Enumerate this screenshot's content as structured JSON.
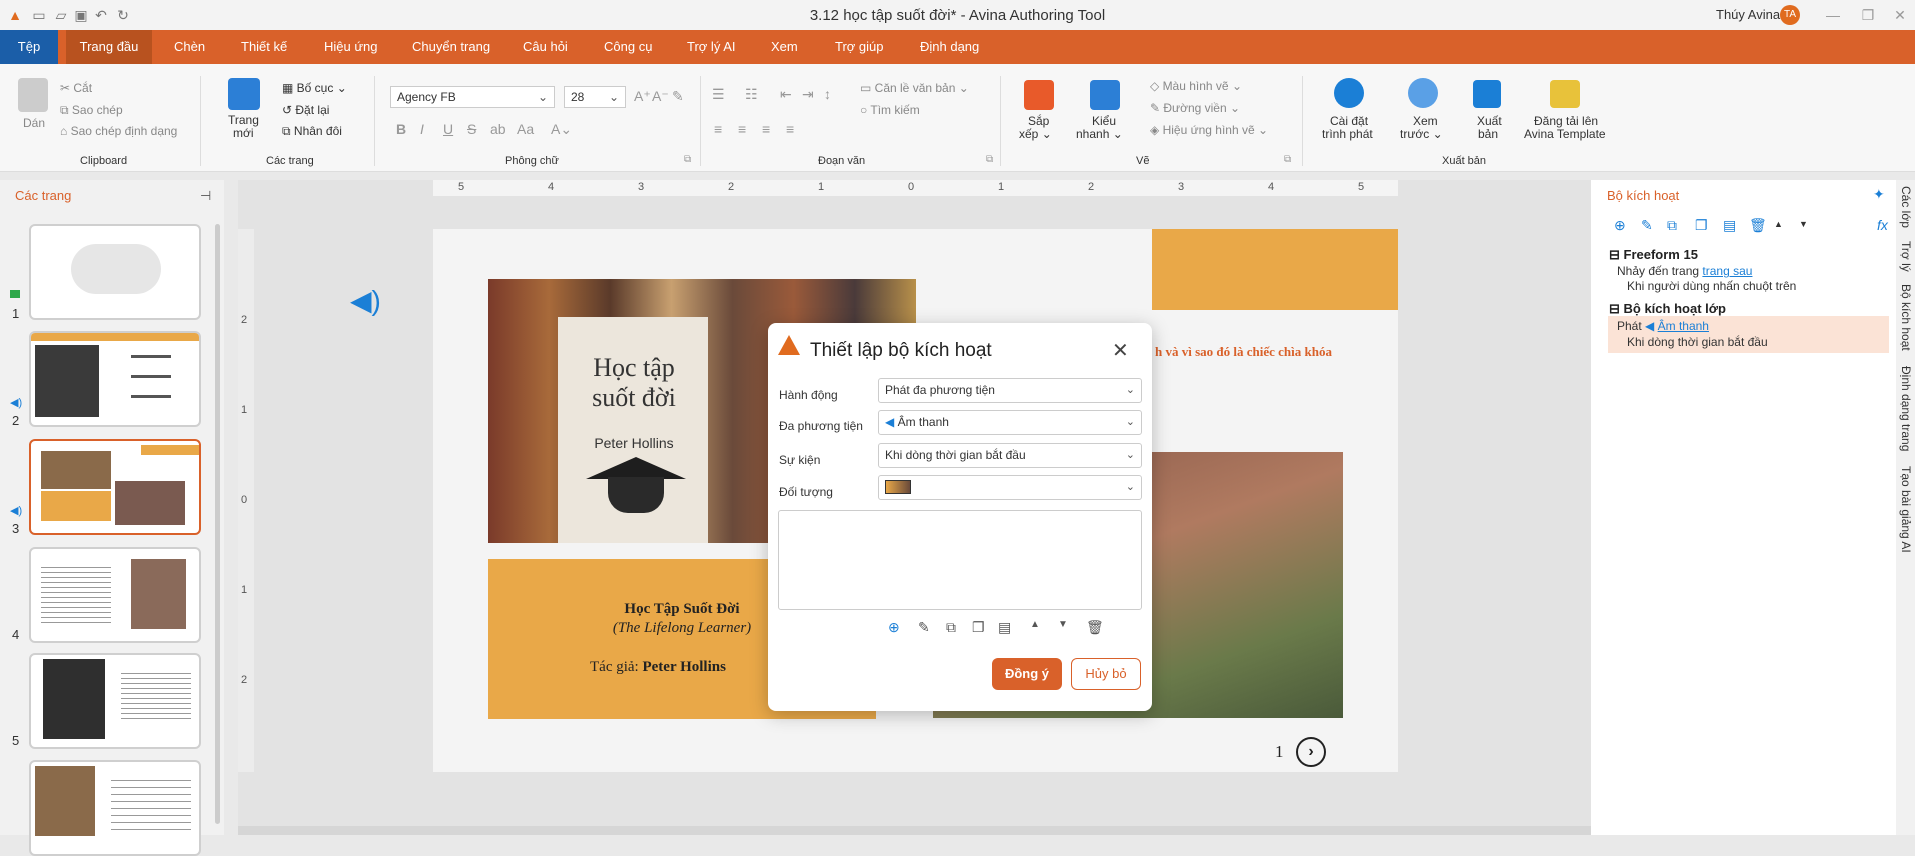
{
  "window": {
    "title": "3.12 học tập suốt đời* - Avina Authoring Tool",
    "user_name": "Thúy Avina",
    "user_initials": "TA"
  },
  "menu": [
    {
      "label": "Tệp"
    },
    {
      "label": "Trang đầu"
    },
    {
      "label": "Chèn"
    },
    {
      "label": "Thiết kế"
    },
    {
      "label": "Hiệu ứng"
    },
    {
      "label": "Chuyển trang"
    },
    {
      "label": "Câu hỏi"
    },
    {
      "label": "Công cụ"
    },
    {
      "label": "Trợ lý AI"
    },
    {
      "label": "Xem"
    },
    {
      "label": "Trợ giúp"
    },
    {
      "label": "Định dạng"
    }
  ],
  "ribbon": {
    "clipboard": {
      "paste": "Dán",
      "cut": "Cắt",
      "copy": "Sao chép",
      "copy_format": "Sao chép định dạng",
      "group": "Clipboard"
    },
    "pages": {
      "new_page": "Trang",
      "new_page2": "mới",
      "layout": "Bố cục",
      "reset": "Đặt lại",
      "duplicate": "Nhân đôi",
      "group": "Các trang"
    },
    "font": {
      "family": "Agency FB",
      "size": "28",
      "group": "Phông chữ"
    },
    "paragraph": {
      "align_text": "Căn lề văn bản",
      "find": "Tìm kiếm",
      "group": "Đoạn văn"
    },
    "draw": {
      "arrange": "Sắp",
      "arrange2": "xếp",
      "quick_style": "Kiểu",
      "quick_style2": "nhanh",
      "shape_color": "Màu hình vẽ",
      "outline": "Đường viền",
      "shape_effect": "Hiệu ứng hình vẽ",
      "group": "Vẽ"
    },
    "publish": {
      "player": "Cài đặt",
      "player2": "trình phát",
      "preview": "Xem",
      "preview2": "trước",
      "export": "Xuất",
      "export2": "bản",
      "upload": "Đăng tải lên",
      "upload2": "Avina Template",
      "group": "Xuất bản"
    }
  },
  "pages_panel": {
    "title": "Các trang",
    "page_numbers": [
      "1",
      "2",
      "3",
      "4",
      "5"
    ]
  },
  "ruler": {
    "ticks": [
      "5",
      "4",
      "3",
      "2",
      "1",
      "0",
      "1",
      "2",
      "3",
      "4",
      "5"
    ],
    "vticks": [
      "2",
      "1",
      "0",
      "1",
      "2"
    ]
  },
  "slide": {
    "book_title": "Học Tập Suốt Đời",
    "book_subtitle": "(The Lifelong Learner)",
    "author_label": "Tác giả:",
    "author": "Peter Hollins",
    "book_cover_title": "Học tập suốt đời",
    "book_cover_author": "Peter Hollins",
    "partial_text": "h và vì sao đó là chiếc chìa khóa",
    "page_number": "1"
  },
  "dialog": {
    "title": "Thiết lập bộ kích hoạt",
    "action_label": "Hành động",
    "action_value": "Phát đa phương tiện",
    "media_label": "Đa phương tiện",
    "media_value": "Âm thanh",
    "event_label": "Sự kiện",
    "event_value": "Khi dòng thời gian bắt đầu",
    "object_label": "Đối tượng",
    "ok": "Đồng ý",
    "cancel": "Hủy bỏ"
  },
  "triggers": {
    "title": "Bộ kích hoạt",
    "group1": "Freeform 15",
    "g1_action": "Nhảy đến trang",
    "g1_link": "trang sau",
    "g1_event": "Khi người dùng nhấn chuột trên",
    "group2": "Bộ kích hoạt lớp",
    "g2_action": "Phát",
    "g2_link": "Âm thanh",
    "g2_event": "Khi dòng thời gian bắt đầu"
  },
  "side_tabs": [
    "Các lớp",
    "Trợ lý",
    "Bộ kích hoạt",
    "Định dạng trang",
    "Tạo bài giảng AI"
  ],
  "colors": {
    "accent": "#d9612a",
    "file_tab": "#1b5ea8",
    "slide_orange": "#e9a848"
  }
}
